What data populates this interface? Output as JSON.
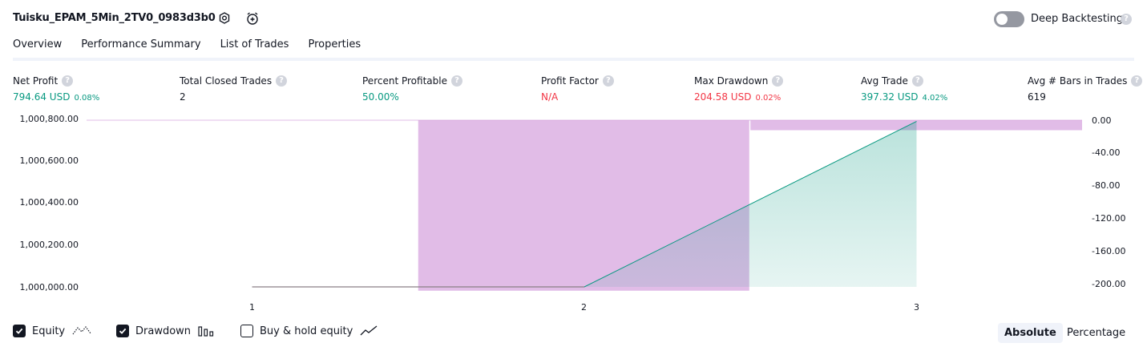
{
  "header": {
    "title": "Tuisku_EPAM_5Min_2TV0_0983d3b0",
    "deep_backtesting_label": "Deep Backtesting",
    "deep_backtesting_on": false,
    "help_glyph": "?"
  },
  "tabs": [
    {
      "label": "Overview",
      "active": true
    },
    {
      "label": "Performance Summary",
      "active": false
    },
    {
      "label": "List of Trades",
      "active": false
    },
    {
      "label": "Properties",
      "active": false
    }
  ],
  "metrics": [
    {
      "label": "Net Profit",
      "value": "794.64 USD",
      "pct": "0.08%",
      "color": "green"
    },
    {
      "label": "Total Closed Trades",
      "value": "2",
      "pct": "",
      "color": "neutral"
    },
    {
      "label": "Percent Profitable",
      "value": "50.00%",
      "pct": "",
      "color": "green"
    },
    {
      "label": "Profit Factor",
      "value": "N/A",
      "pct": "",
      "color": "red"
    },
    {
      "label": "Max Drawdown",
      "value": "204.58 USD",
      "pct": "0.02%",
      "color": "red"
    },
    {
      "label": "Avg Trade",
      "value": "397.32 USD",
      "pct": "4.02%",
      "color": "green"
    },
    {
      "label": "Avg # Bars in Trades",
      "value": "619",
      "pct": "",
      "color": "neutral"
    }
  ],
  "chart_data": {
    "type": "area",
    "x_ticks": [
      "1",
      "2",
      "3"
    ],
    "left_axis": {
      "ticks": [
        "1,000,800.00",
        "1,000,600.00",
        "1,000,400.00",
        "1,000,200.00",
        "1,000,000.00"
      ],
      "ylim": [
        1000000,
        1000800
      ]
    },
    "right_axis": {
      "ticks": [
        "0.00",
        "-40.00",
        "-80.00",
        "-120.00",
        "-160.00",
        "-200.00"
      ],
      "ylim": [
        -200,
        0
      ]
    },
    "series": [
      {
        "name": "Equity",
        "type": "line",
        "color": "#089981",
        "x": [
          1,
          2,
          3
        ],
        "values": [
          1000000,
          1000000,
          1000794.64
        ]
      },
      {
        "name": "Drawdown",
        "type": "bar",
        "color": "#ce93d8",
        "x": [
          2,
          3
        ],
        "values": [
          -204.58,
          -12
        ]
      }
    ]
  },
  "legend": [
    {
      "label": "Equity",
      "checked": true,
      "icon": "equity-line-icon"
    },
    {
      "label": "Drawdown",
      "checked": true,
      "icon": "drawdown-bars-icon"
    },
    {
      "label": "Buy & hold equity",
      "checked": false,
      "icon": "buy-hold-line-icon"
    }
  ],
  "scale_toggle": {
    "absolute_label": "Absolute",
    "percentage_label": "Percentage",
    "selected": "Absolute"
  },
  "colors": {
    "green": "#089981",
    "red": "#f23645",
    "purple": "#ce93d8",
    "text": "#131722"
  }
}
